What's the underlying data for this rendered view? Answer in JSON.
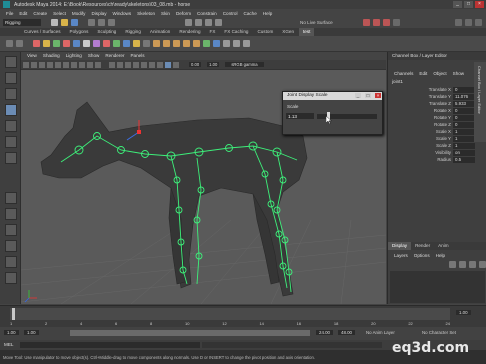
{
  "window": {
    "title": "Autodesk Maya 2014: E:\\Book\\Resources\\ch\\ready\\skeletons\\03_08.mb - horse"
  },
  "menubar": [
    "File",
    "Edit",
    "Create",
    "Select",
    "Modify",
    "Display",
    "Windows",
    "Skeleton",
    "Skin",
    "Deform",
    "Constrain",
    "Control",
    "Cache",
    "Help"
  ],
  "statusline": {
    "mode": "Rigging",
    "live_surface": "No Live Surface"
  },
  "shelf_tabs": [
    "Curves / Surfaces",
    "Polygons",
    "Sculpting",
    "Rigging",
    "Animation",
    "Rendering",
    "FX",
    "FX Caching",
    "Custom",
    "XGen",
    "test"
  ],
  "shelf_active": "test",
  "viewport": {
    "menu": [
      "View",
      "Shading",
      "Lighting",
      "Show",
      "Renderer",
      "Panels"
    ],
    "near": "0.00",
    "far": "1.00",
    "color_space": "sRGB gamma",
    "camera": "persp"
  },
  "channel_box": {
    "title": "Channel Box / Layer Editor",
    "menu": [
      "Channels",
      "Edit",
      "Object",
      "Show"
    ],
    "object": "joint1",
    "attributes": [
      {
        "name": "Translate X",
        "value": "0"
      },
      {
        "name": "Translate Y",
        "value": "11.076"
      },
      {
        "name": "Translate Z",
        "value": "5.933"
      },
      {
        "name": "Rotate X",
        "value": "0"
      },
      {
        "name": "Rotate Y",
        "value": "0"
      },
      {
        "name": "Rotate Z",
        "value": "0"
      },
      {
        "name": "Scale X",
        "value": "1"
      },
      {
        "name": "Scale Y",
        "value": "1"
      },
      {
        "name": "Scale Z",
        "value": "1"
      },
      {
        "name": "Visibility",
        "value": "on"
      },
      {
        "name": "Radius",
        "value": "0.5"
      }
    ],
    "side_tab": "Channel Box / Layer Editor"
  },
  "layers": {
    "tabs": [
      "Display",
      "Render",
      "Anim"
    ],
    "active": "Display",
    "menu": [
      "Layers",
      "Options",
      "Help"
    ]
  },
  "dialog": {
    "title": "Joint Display Scale",
    "label": "Scale",
    "value": "1.13"
  },
  "timeline": {
    "start": "1.00",
    "end": "24.00",
    "range_end": "48.00",
    "current": "1.00",
    "anim_layer": "No Anim Layer",
    "char_set": "No Character Set",
    "ticks": [
      "1",
      "2",
      "4",
      "6",
      "8",
      "10",
      "12",
      "14",
      "16",
      "18",
      "20",
      "22",
      "24"
    ]
  },
  "cmdline": {
    "label": "MEL"
  },
  "help": {
    "text": "Move Tool: Use manipulator to move object(s). Ctrl+Middle-drag to move components along normals. Use D or INSERT to change the pivot position and axis orientation."
  },
  "watermark": "eq3d.com"
}
